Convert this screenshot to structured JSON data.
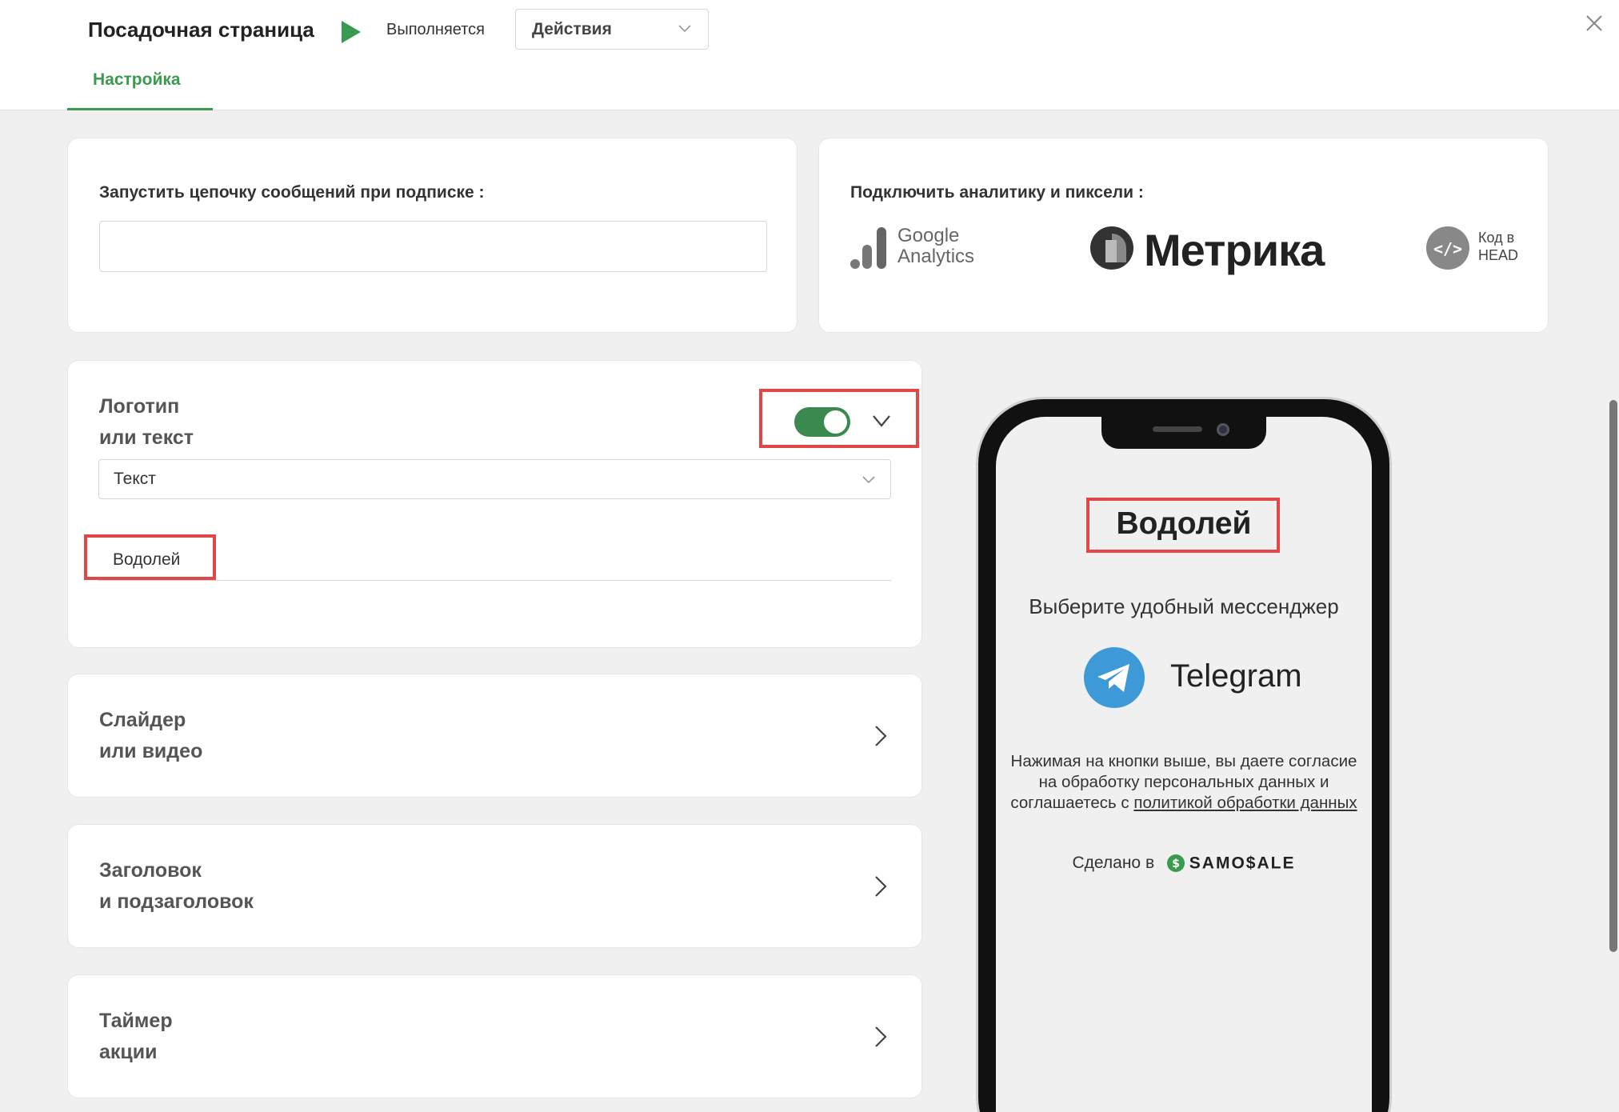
{
  "header": {
    "title": "Посадочная страница",
    "status": "Выполняется",
    "actions_label": "Действия",
    "tab": "Настройка"
  },
  "chain_card": {
    "label": "Запустить цепочку сообщений при подписке :",
    "input_value": ""
  },
  "analytics_card": {
    "label": "Подключить аналитику и пиксели :",
    "google_analytics": [
      "Google",
      "Analytics"
    ],
    "metrika": "Метрика",
    "code_in_head": [
      "Код в",
      "HEAD"
    ]
  },
  "logo_card": {
    "title": [
      "Логотип",
      "или текст"
    ],
    "toggle_on": true,
    "type_value": "Текст",
    "text_value": "Водолей"
  },
  "sections": [
    {
      "title": [
        "Слайдер",
        "или видео"
      ]
    },
    {
      "title": [
        "Заголовок",
        "и подзаголовок"
      ]
    },
    {
      "title": [
        "Таймер",
        "акции"
      ]
    }
  ],
  "preview": {
    "title": "Водолей",
    "subtitle": "Выберите удобный мессенджер",
    "messenger": "Telegram",
    "consent_line1": "Нажимая на кнопки выше, вы даете согласие",
    "consent_line2": "на обработку персональных данных и",
    "consent_line3_prefix": "соглашаетесь с ",
    "consent_link": "политикой обработки данных",
    "made_in": "Сделано в",
    "brand": "SAMO$ALE"
  },
  "colors": {
    "accent": "#3a9a4f",
    "highlight": "#e04848",
    "telegram": "#3d9ad7"
  }
}
